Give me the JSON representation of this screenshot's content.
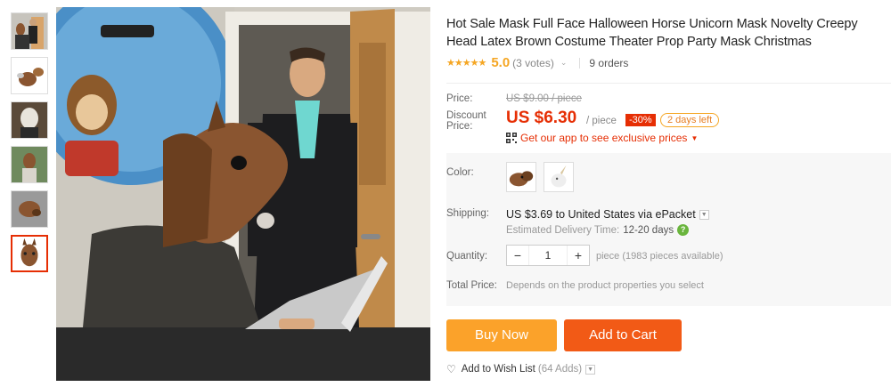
{
  "product": {
    "title": "Hot Sale Mask Full Face Halloween Horse Unicorn Mask Novelty Creepy Head Latex Brown Costume Theater Prop Party Mask Christmas",
    "stars": "★★★★★",
    "rating": "5.0",
    "votes": "(3 votes)",
    "orders": "9 orders"
  },
  "price": {
    "price_label": "Price:",
    "old_price": "US $9.00 / piece",
    "discount_label": "Discount Price:",
    "current_price": "US $6.30",
    "per_piece": "/ piece",
    "discount_badge": "-30%",
    "days_left": "2 days left",
    "app_promo": "Get our app to see exclusive prices"
  },
  "options": {
    "color_label": "Color:",
    "color_options": [
      "horse-mask",
      "unicorn-mask"
    ],
    "shipping_label": "Shipping:",
    "shipping_cost": "US $3.69",
    "shipping_to": "to",
    "shipping_dest": "United States via ePacket",
    "eta_label": "Estimated Delivery Time:",
    "eta_value": "12-20 days",
    "quantity_label": "Quantity:",
    "quantity_value": "1",
    "minus": "−",
    "plus": "+",
    "pieces_available": "piece (1983 pieces available)",
    "total_label": "Total Price:",
    "total_value": "Depends on the product properties you select"
  },
  "actions": {
    "buy_now": "Buy Now",
    "add_to_cart": "Add to Cart",
    "wishlist": "Add to Wish List",
    "wishlist_count": "(64 Adds)"
  },
  "colors": {
    "accent_red": "#e62e04",
    "star_orange": "#f5a623",
    "buy_orange": "#fba22a",
    "cart_orange": "#f25a16"
  }
}
